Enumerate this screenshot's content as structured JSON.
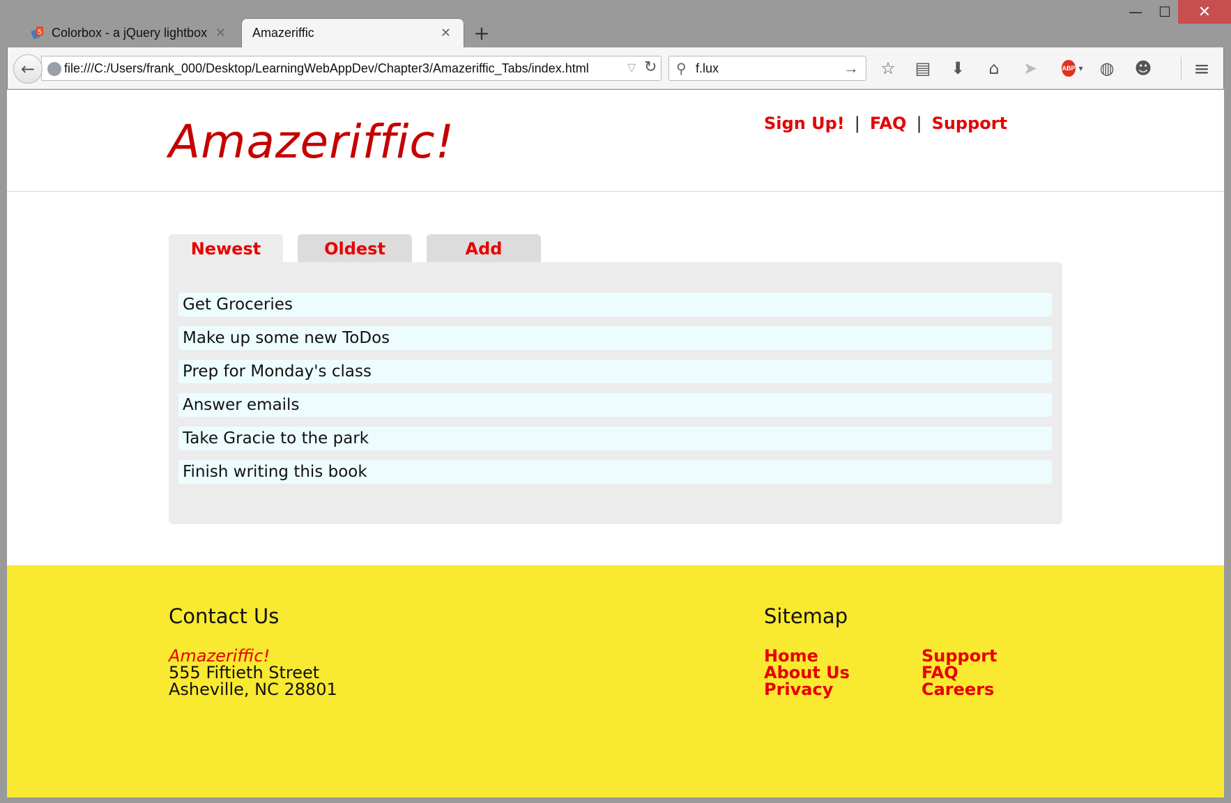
{
  "browser": {
    "tabs": [
      {
        "title": "Colorbox - a jQuery lightbox",
        "active": false
      },
      {
        "title": "Amazeriffic",
        "active": true
      }
    ],
    "url": "file:///C:/Users/frank_000/Desktop/LearningWebAppDev/Chapter3/Amazeriffic_Tabs/index.html",
    "search_value": "f.lux",
    "toolbar_icons": [
      "bookmark-star-icon",
      "reading-list-icon",
      "download-icon",
      "home-icon",
      "send-icon",
      "adblock-plus-icon",
      "globe-icon",
      "chat-icon",
      "menu-icon"
    ]
  },
  "site": {
    "logo": "Amazeriffic!",
    "nav": {
      "signup": "Sign Up!",
      "faq": "FAQ",
      "support": "Support",
      "separator": "|"
    },
    "tabs": [
      "Newest",
      "Oldest",
      "Add"
    ],
    "active_tab": "Newest",
    "todos": [
      "Get Groceries",
      "Make up some new ToDos",
      "Prep for Monday's class",
      "Answer emails",
      "Take Gracie to the park",
      "Finish writing this book"
    ],
    "footer": {
      "contact_title": "Contact Us",
      "company": "Amazeriffic!",
      "street": "555 Fiftieth Street",
      "city": "Asheville, NC 28801",
      "sitemap_title": "Sitemap",
      "sitemap_col1": [
        "Home",
        "About Us",
        "Privacy"
      ],
      "sitemap_col2": [
        "Support",
        "FAQ",
        "Careers"
      ]
    },
    "colors": {
      "accent": "#e60000",
      "logo": "#c40000",
      "footer_bg": "#f9e931",
      "tab_panel": "#ececec",
      "todo_bg": "#edfdff"
    }
  }
}
